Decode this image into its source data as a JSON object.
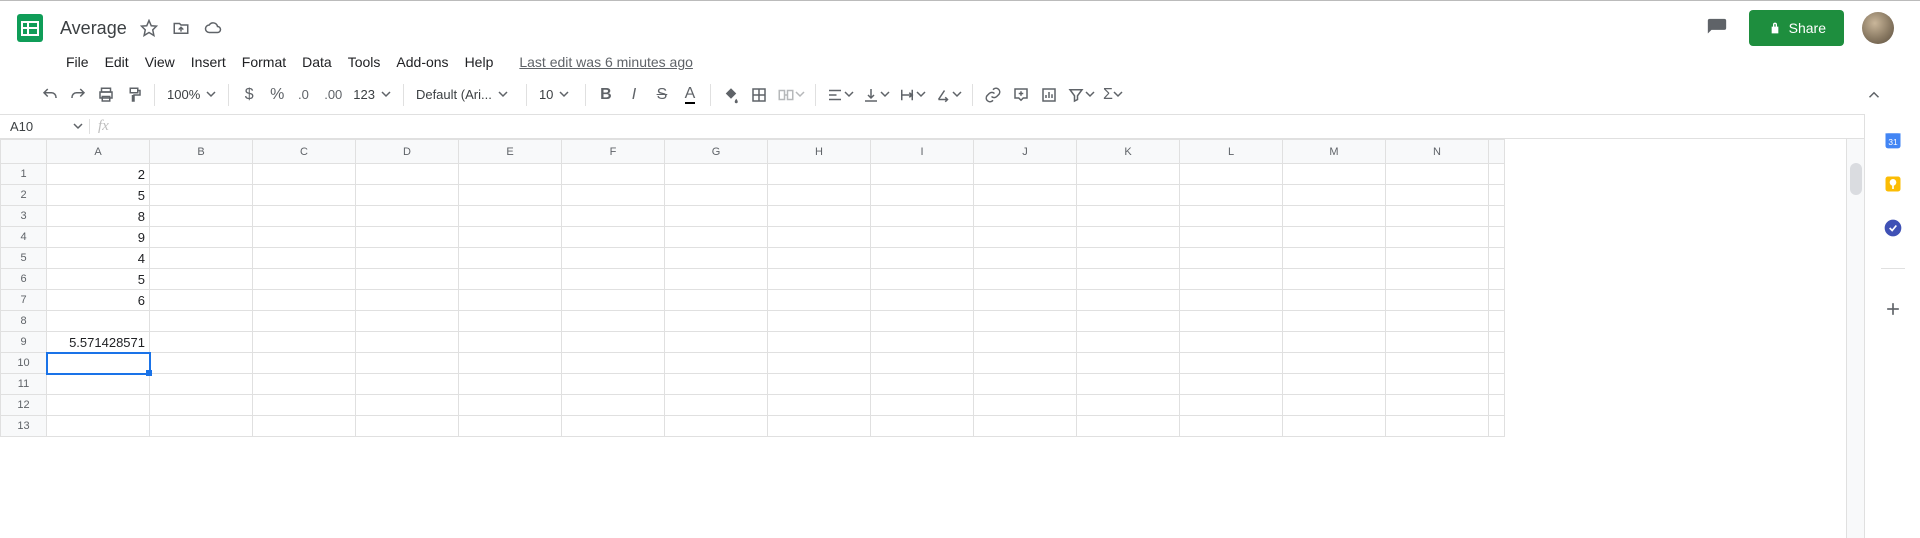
{
  "doc": {
    "title": "Average",
    "last_edit": "Last edit was 6 minutes ago"
  },
  "menus": [
    "File",
    "Edit",
    "View",
    "Insert",
    "Format",
    "Data",
    "Tools",
    "Add-ons",
    "Help"
  ],
  "toolbar": {
    "zoom": "100%",
    "font": "Default (Ari...",
    "font_size": "10",
    "number_format": "123"
  },
  "share": {
    "label": "Share"
  },
  "name_box": "A10",
  "formula": "",
  "columns": [
    "A",
    "B",
    "C",
    "D",
    "E",
    "F",
    "G",
    "H",
    "I",
    "J",
    "K",
    "L",
    "M",
    "N"
  ],
  "rows": [
    1,
    2,
    3,
    4,
    5,
    6,
    7,
    8,
    9,
    10,
    11,
    12,
    13
  ],
  "cells": {
    "A1": "2",
    "A2": "5",
    "A3": "8",
    "A4": "9",
    "A5": "4",
    "A6": "5",
    "A7": "6",
    "A9": "5.571428571"
  },
  "selected_cell": "A10",
  "side_panel": {
    "calendar_day": "31"
  }
}
